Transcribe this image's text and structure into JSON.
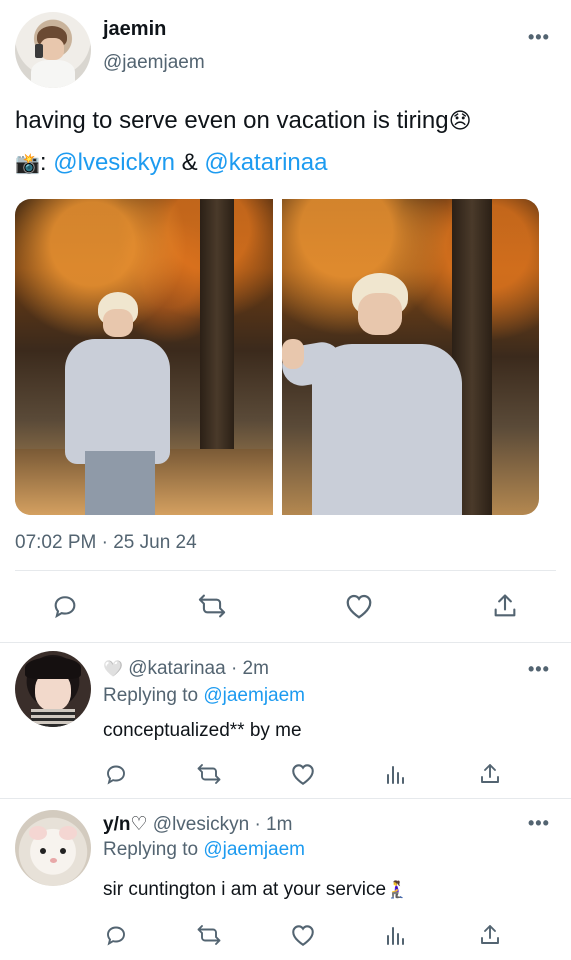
{
  "tweet": {
    "author_name": "jaemin",
    "author_handle": "@jaemjaem",
    "text_line1": "having to serve even on vacation is tiring",
    "text_line1_emoji": "😞",
    "camera_emoji": "📸",
    "colon": ":",
    "mention1": "@lvesickyn",
    "amp": "&",
    "mention2": "@katarinaa",
    "timestamp": "07:02 PM · 25 Jun 24",
    "more_label": "•••"
  },
  "actions": {
    "reply_icon": "reply-icon",
    "retweet_icon": "retweet-icon",
    "like_icon": "heart-icon",
    "share_icon": "share-icon",
    "stats_icon": "stats-icon"
  },
  "replies": [
    {
      "name_emoji": "🤍",
      "name": "",
      "handle": "@katarinaa",
      "time": "· 2m",
      "replying_to_label": "Replying to",
      "replying_to_handle": "@jaemjaem",
      "text": "conceptualized** by me",
      "more_label": "•••"
    },
    {
      "name_emoji": "",
      "name": "y/n♡",
      "handle": "@lvesickyn",
      "time": "· 1m",
      "replying_to_label": "Replying to",
      "replying_to_handle": "@jaemjaem",
      "text": "sir cuntington i am at your service",
      "text_emoji": "🧎‍♀️",
      "more_label": "•••"
    }
  ],
  "colors": {
    "link": "#1d9bf0",
    "muted": "#536471",
    "text": "#0f1419"
  }
}
